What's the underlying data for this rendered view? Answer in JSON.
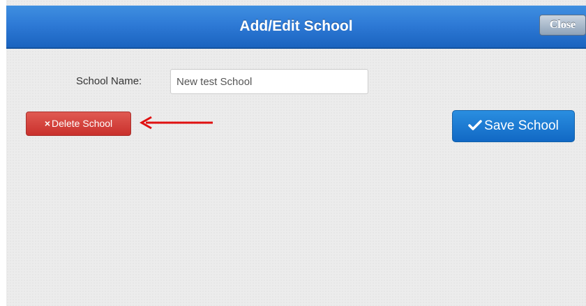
{
  "header": {
    "title": "Add/Edit School",
    "close_label": "Close"
  },
  "form": {
    "school_name_label": "School Name:",
    "school_name_value": "New test School"
  },
  "actions": {
    "delete_icon": "×",
    "delete_label": "Delete School",
    "save_label": "Save School"
  },
  "icons": {
    "delete": "x-icon",
    "save": "check-icon",
    "annotation": "red-arrow-icon"
  },
  "colors": {
    "header_blue": "#2e7ad6",
    "delete_red": "#c9302c",
    "save_blue": "#1a7ad2",
    "annotation_red": "#e01010"
  }
}
